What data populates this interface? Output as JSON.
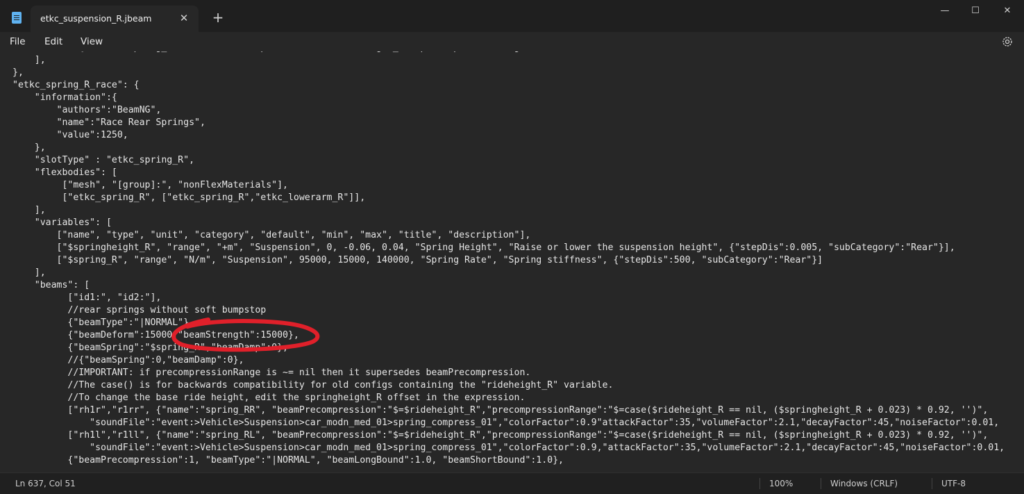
{
  "window": {
    "tab_title": "etkc_suspension_R.jbeam",
    "tab_close": "✕",
    "new_tab": "+",
    "minimize": "—",
    "maximize": "☐",
    "close": "✕"
  },
  "menu": {
    "file": "File",
    "edit": "Edit",
    "view": "View"
  },
  "editor": {
    "lines": [
      "            {\"name\":\"spring_RL\",  \"beamPrecompression\":\"$=$rideheight_R\",\"precompressionRange\":\"$=case(\"",
      "    ],",
      "},",
      "\"etkc_spring_R_race\": {",
      "    \"information\":{",
      "        \"authors\":\"BeamNG\",",
      "        \"name\":\"Race Rear Springs\",",
      "        \"value\":1250,",
      "    },",
      "    \"slotType\" : \"etkc_spring_R\",",
      "    \"flexbodies\": [",
      "         [\"mesh\", \"[group]:\", \"nonFlexMaterials\"],",
      "         [\"etkc_spring_R\", [\"etkc_spring_R\",\"etkc_lowerarm_R\"]],",
      "    ],",
      "    \"variables\": [",
      "        [\"name\", \"type\", \"unit\", \"category\", \"default\", \"min\", \"max\", \"title\", \"description\"],",
      "        [\"$springheight_R\", \"range\", \"+m\", \"Suspension\", 0, -0.06, 0.04, \"Spring Height\", \"Raise or lower the suspension height\", {\"stepDis\":0.005, \"subCategory\":\"Rear\"}],",
      "        [\"$spring_R\", \"range\", \"N/m\", \"Suspension\", 95000, 15000, 140000, \"Spring Rate\", \"Spring stiffness\", {\"stepDis\":500, \"subCategory\":\"Rear\"}]",
      "    ],",
      "    \"beams\": [",
      "          [\"id1:\", \"id2:\"],",
      "          //rear springs without soft bumpstop",
      "          {\"beamType\":\"|NORMAL\"},",
      "          {\"beamDeform\":15000,\"beamStrength\":15000},",
      "          {\"beamSpring\":\"$spring_R\",\"beamDamp\":0},",
      "          //{\"beamSpring\":0,\"beamDamp\":0},",
      "          //IMPORTANT: if precompressionRange is ~= nil then it supersedes beamPrecompression.",
      "          //The case() is for backwards compatibility for old configs containing the \"rideheight_R\" variable.",
      "          //To change the base ride height, edit the springheight_R offset in the expression.",
      "          [\"rh1r\",\"r1rr\", {\"name\":\"spring_RR\", \"beamPrecompression\":\"$=$rideheight_R\",\"precompressionRange\":\"$=case($rideheight_R == nil, ($springheight_R + 0.023) * 0.92, '')\",",
      "              \"soundFile\":\"event:>Vehicle>Suspension>car_modn_med_01>spring_compress_01\",\"colorFactor\":0.9\"attackFactor\":35,\"volumeFactor\":2.1,\"decayFactor\":45,\"noiseFactor\":0.01,",
      "          [\"rh1l\",\"r1ll\", {\"name\":\"spring_RL\", \"beamPrecompression\":\"$=$rideheight_R\",\"precompressionRange\":\"$=case($rideheight_R == nil, ($springheight_R + 0.023) * 0.92, '')\",",
      "              \"soundFile\":\"event:>Vehicle>Suspension>car_modn_med_01>spring_compress_01\",\"colorFactor\":0.9,\"attackFactor\":35,\"volumeFactor\":2.1,\"decayFactor\":45,\"noiseFactor\":0.01,",
      "          {\"beamPrecompression\":1, \"beamType\":\"|NORMAL\", \"beamLongBound\":1.0, \"beamShortBound\":1.0},"
    ]
  },
  "statusbar": {
    "position": "Ln 637, Col 51",
    "zoom": "100%",
    "line_ending": "Windows (CRLF)",
    "encoding": "UTF-8"
  },
  "colors": {
    "background": "#272727",
    "titlebar": "#1f1f1f",
    "annotation": "#e0202a",
    "app_icon": "#5fb2f0"
  },
  "icons": [
    "notepad-app-icon",
    "close-icon",
    "plus-icon",
    "minimize-icon",
    "maximize-icon",
    "gear-icon"
  ]
}
